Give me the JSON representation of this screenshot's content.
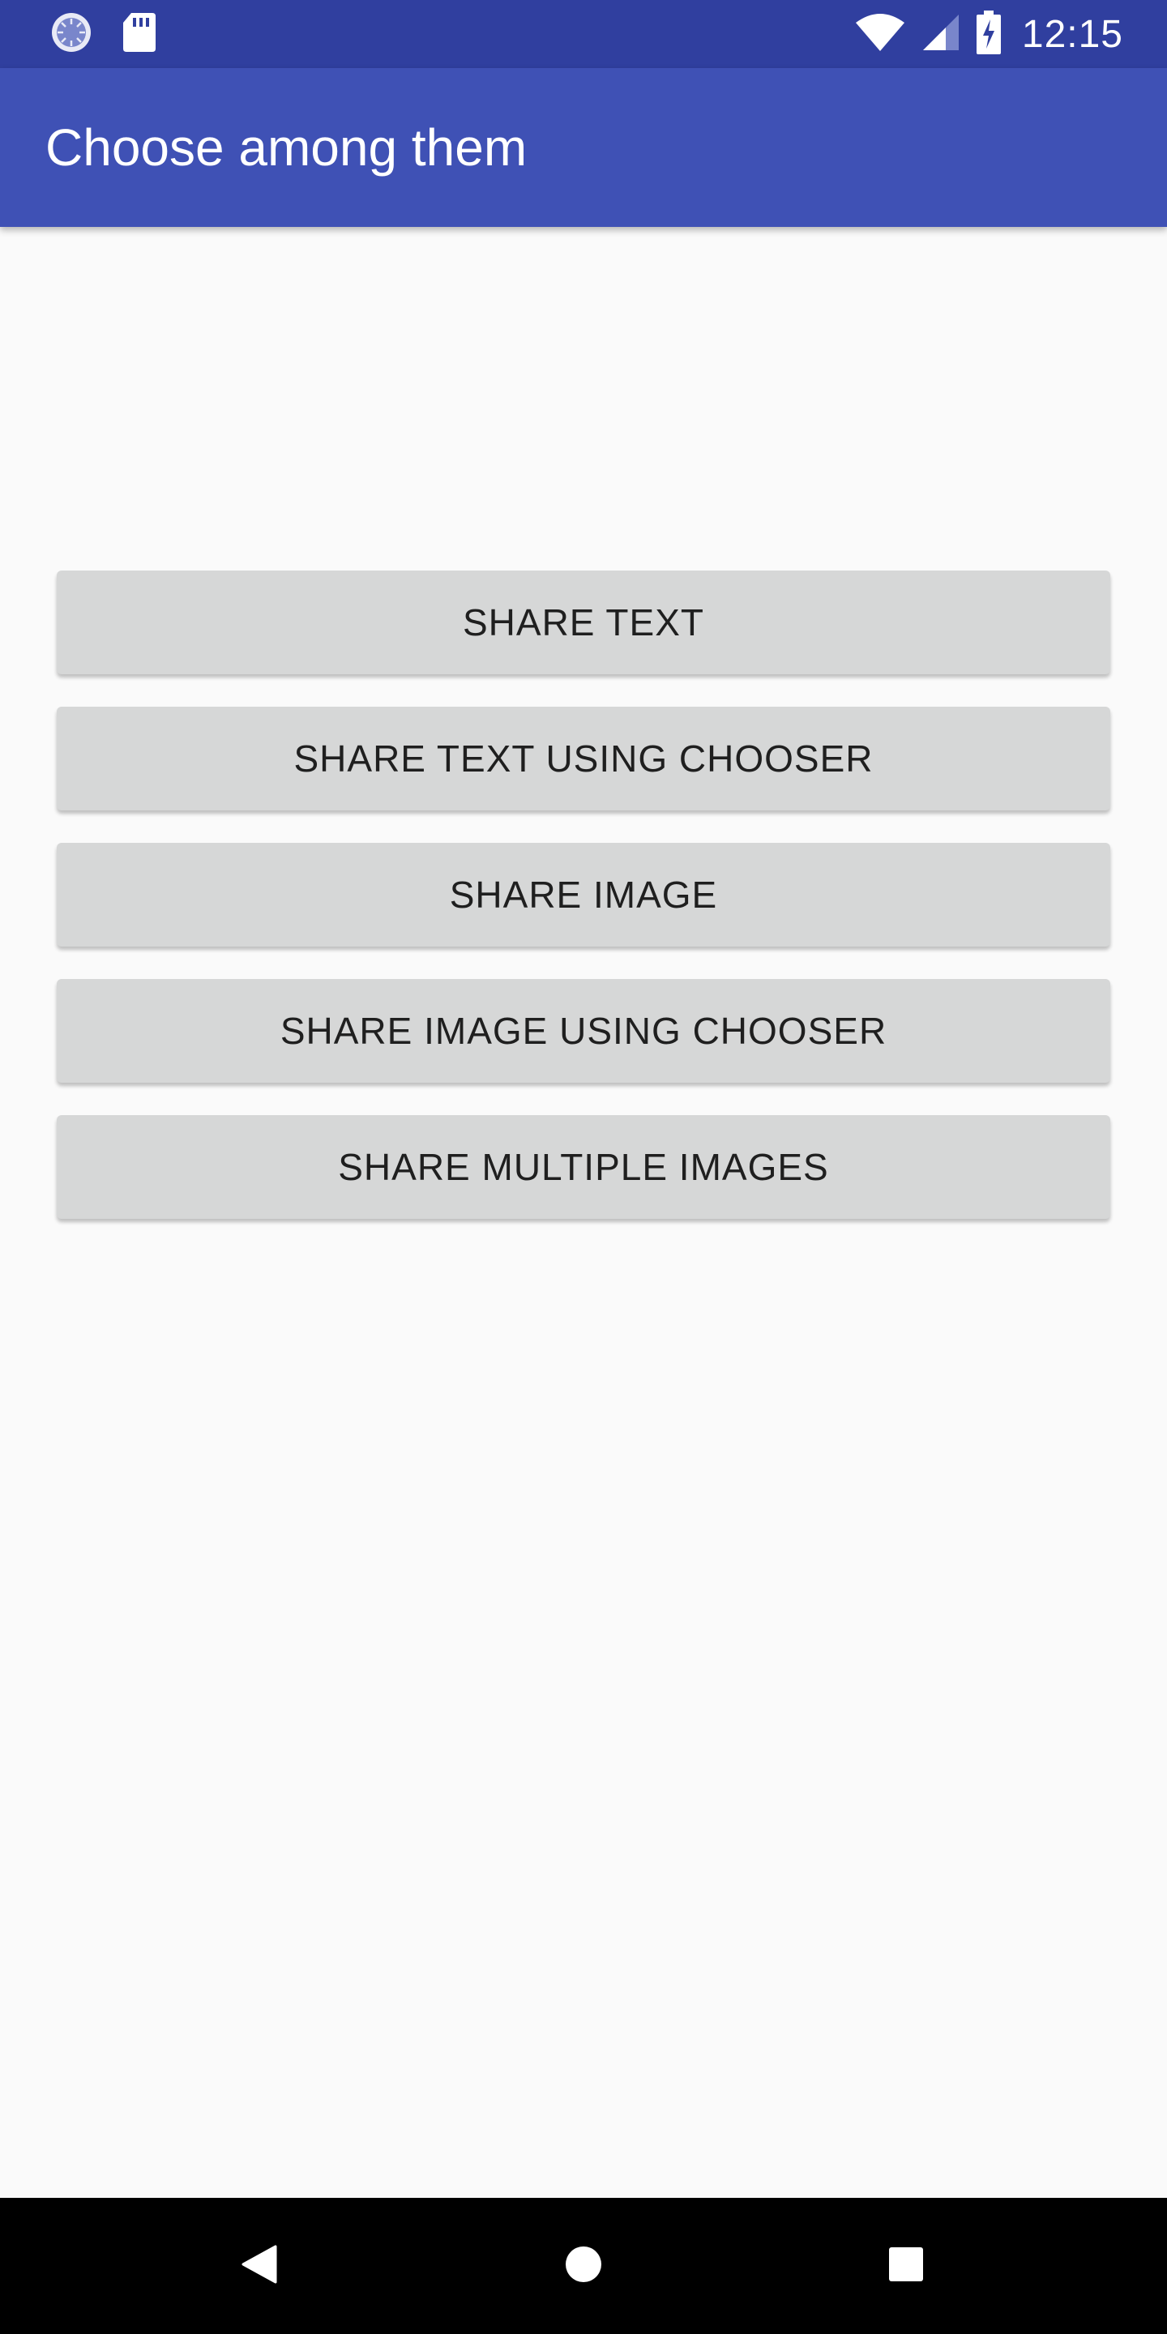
{
  "status_bar": {
    "time": "12:15",
    "left_icons": [
      "sync-icon",
      "sd-card-icon"
    ],
    "right_icons": [
      "wifi-icon",
      "cell-signal-icon",
      "battery-charging-icon"
    ],
    "background": "#303f9f"
  },
  "app_bar": {
    "title": "Choose among them",
    "background": "#3f51b5"
  },
  "buttons": [
    {
      "label": "SHARE TEXT"
    },
    {
      "label": "SHARE TEXT USING CHOOSER"
    },
    {
      "label": "SHARE IMAGE"
    },
    {
      "label": "SHARE IMAGE USING CHOOSER"
    },
    {
      "label": "SHARE MULTIPLE IMAGES"
    }
  ],
  "nav_bar": {
    "icons": [
      "back-icon",
      "home-icon",
      "recents-icon"
    ]
  }
}
